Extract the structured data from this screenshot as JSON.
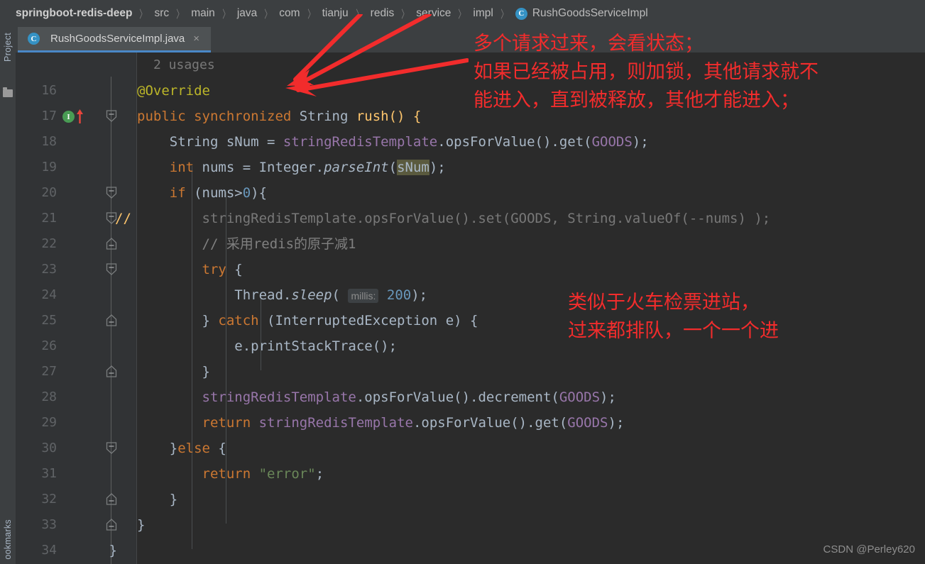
{
  "breadcrumb": {
    "items": [
      {
        "label": "springboot-redis-deep",
        "bold": true
      },
      {
        "label": "src",
        "bold": false
      },
      {
        "label": "main",
        "bold": false
      },
      {
        "label": "java",
        "bold": false
      },
      {
        "label": "com",
        "bold": false
      },
      {
        "label": "tianju",
        "bold": false
      },
      {
        "label": "redis",
        "bold": false
      },
      {
        "label": "service",
        "bold": false
      },
      {
        "label": "impl",
        "bold": false
      }
    ],
    "separator": "〉",
    "class_badge": "C",
    "class_name": "RushGoodsServiceImpl"
  },
  "tool_windows": {
    "project_label": "Project",
    "bookmarks_label": "ookmarks"
  },
  "tab": {
    "badge": "C",
    "label": "RushGoodsServiceImpl.java",
    "close": "×"
  },
  "editor": {
    "usages_label": "2 usages",
    "accent_color": "#4a88c7",
    "background": "#2b2b2b",
    "gutter_background": "#313335",
    "lines": [
      {
        "num": "16"
      },
      {
        "num": "17"
      },
      {
        "num": "18"
      },
      {
        "num": "19"
      },
      {
        "num": "20"
      },
      {
        "num": "21"
      },
      {
        "num": "22"
      },
      {
        "num": "23"
      },
      {
        "num": "24"
      },
      {
        "num": "25"
      },
      {
        "num": "26"
      },
      {
        "num": "27"
      },
      {
        "num": "28"
      },
      {
        "num": "29"
      },
      {
        "num": "30"
      },
      {
        "num": "31"
      },
      {
        "num": "32"
      },
      {
        "num": "33"
      },
      {
        "num": "34"
      }
    ],
    "code": {
      "l16": "@Override",
      "l17_a": "public synchronized ",
      "l17_b": "String",
      "l17_c": " rush() {",
      "l18_a": "    String sNum = ",
      "l18_b": "stringRedisTemplate",
      "l18_c": ".opsForValue().get(",
      "l18_d": "GOODS",
      "l18_e": ");",
      "l19_a": "    int",
      "l19_b": " nums = Integer.",
      "l19_c": "parseInt",
      "l19_d": "(",
      "l19_e": "sNum",
      "l19_f": ");",
      "l20_a": "    if",
      "l20_b": " (nums>",
      "l20_c": "0",
      "l20_d": "){",
      "l21": "        stringRedisTemplate.opsForValue().set(GOODS, String.valueOf(--nums) );",
      "l21_fold_marker": "//",
      "l22": "        // 采用redis的原子减1",
      "l23_a": "        try",
      "l23_b": " {",
      "l24_a": "            Thread.",
      "l24_b": "sleep",
      "l24_c": "( ",
      "l24_hint": "millis:",
      "l24_d": " ",
      "l24_e": "200",
      "l24_f": ");",
      "l25_a": "        } ",
      "l25_b": "catch",
      "l25_c": " (InterruptedException e) {",
      "l26": "            e.printStackTrace();",
      "l27": "        }",
      "l28_a": "        ",
      "l28_b": "stringRedisTemplate",
      "l28_c": ".opsForValue().decrement(",
      "l28_d": "GOODS",
      "l28_e": ");",
      "l29_a": "        return",
      "l29_b": " ",
      "l29_c": "stringRedisTemplate",
      "l29_d": ".opsForValue().get(",
      "l29_e": "GOODS",
      "l29_f": ");",
      "l30_a": "    }",
      "l30_b": "else",
      "l30_c": " {",
      "l31_a": "        return",
      "l31_b": " ",
      "l31_c": "\"error\"",
      "l31_d": ";",
      "l32": "    }",
      "l33": "}",
      "l34": " }"
    },
    "gutter_icons": {
      "implementing_method": "I",
      "override_marker": "override-up-arrow"
    }
  },
  "annotations": {
    "color": "#f22c2c",
    "note1_line1": "多个请求过来，会看状态；",
    "note1_line2": "如果已经被占用，则加锁，其他请求就不",
    "note1_line3": "能进入，直到被释放，其他才能进入；",
    "note2_line1": "类似于火车检票进站，",
    "note2_line2": "过来都排队，一个一个进"
  },
  "watermark": {
    "text": "CSDN @Perley620"
  }
}
